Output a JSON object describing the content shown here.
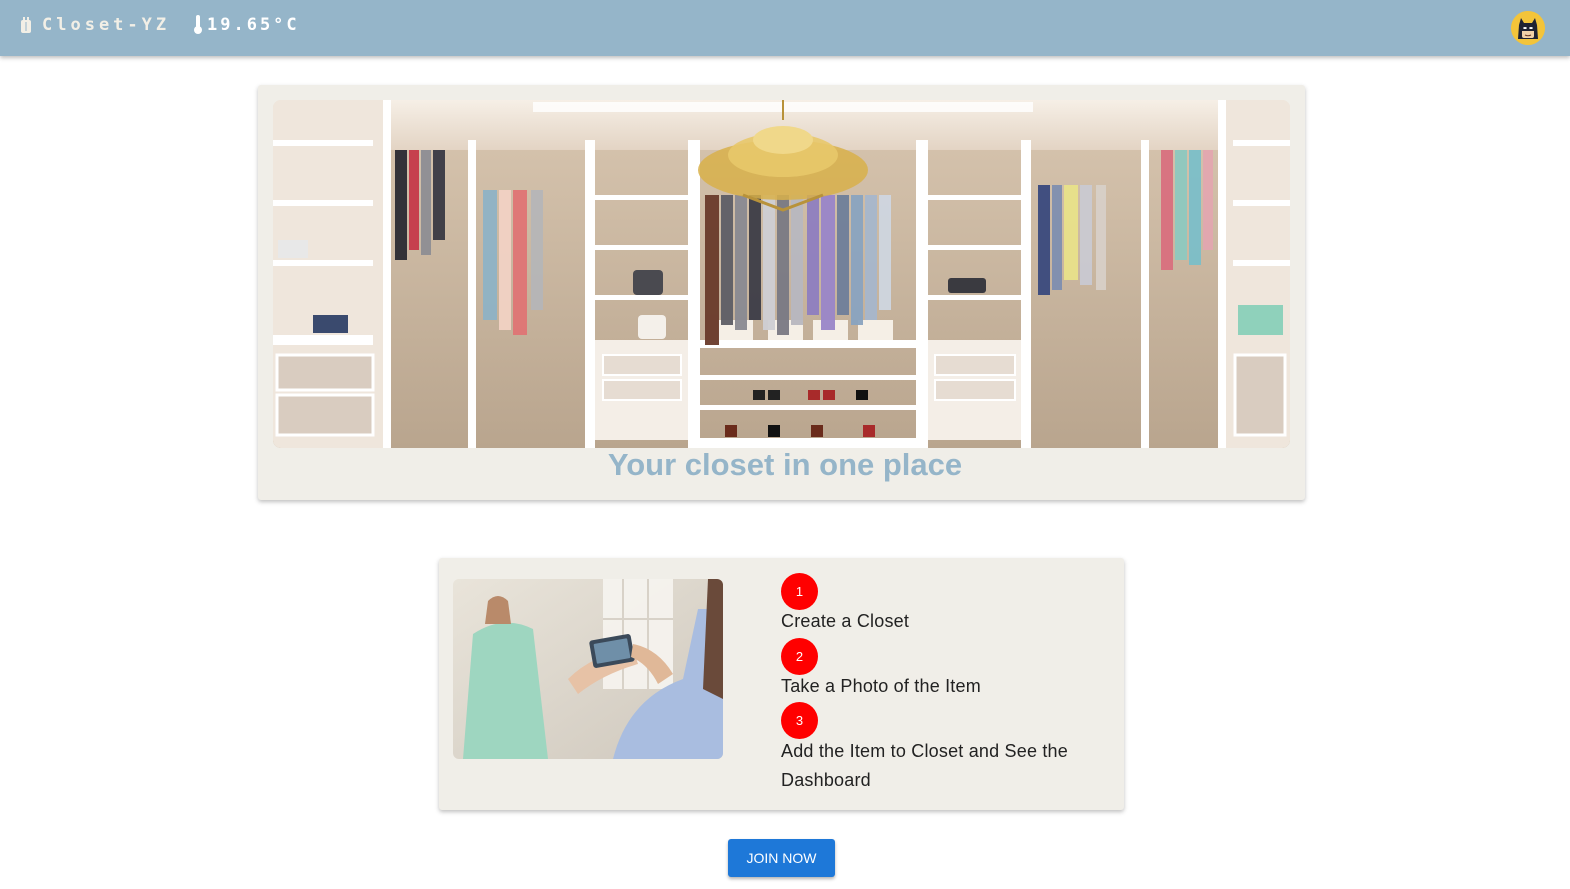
{
  "appbar": {
    "brand_icon": "closet-icon",
    "brand_name": "Closet-YZ",
    "temperature_icon": "thermometer-icon",
    "temperature": "19.65°C",
    "avatar_icon": "batman-avatar-icon"
  },
  "hero": {
    "image": "walk-in-closet-photo",
    "title": "Your closet in one place"
  },
  "steps": {
    "image": "phone-photo-of-clothing-photo",
    "items": [
      {
        "number": "1",
        "label": "Create a Closet"
      },
      {
        "number": "2",
        "label": "Take a Photo of the Item"
      },
      {
        "number": "3",
        "label": "Add the Item to Closet and See the Dashboard"
      }
    ]
  },
  "cta": {
    "label": "Join Now"
  },
  "colors": {
    "appbar": "#95b5c9",
    "card_background": "#f0eee8",
    "title_text": "#95b5c9",
    "step_badge": "#ff0000",
    "button": "#1e78d8"
  }
}
